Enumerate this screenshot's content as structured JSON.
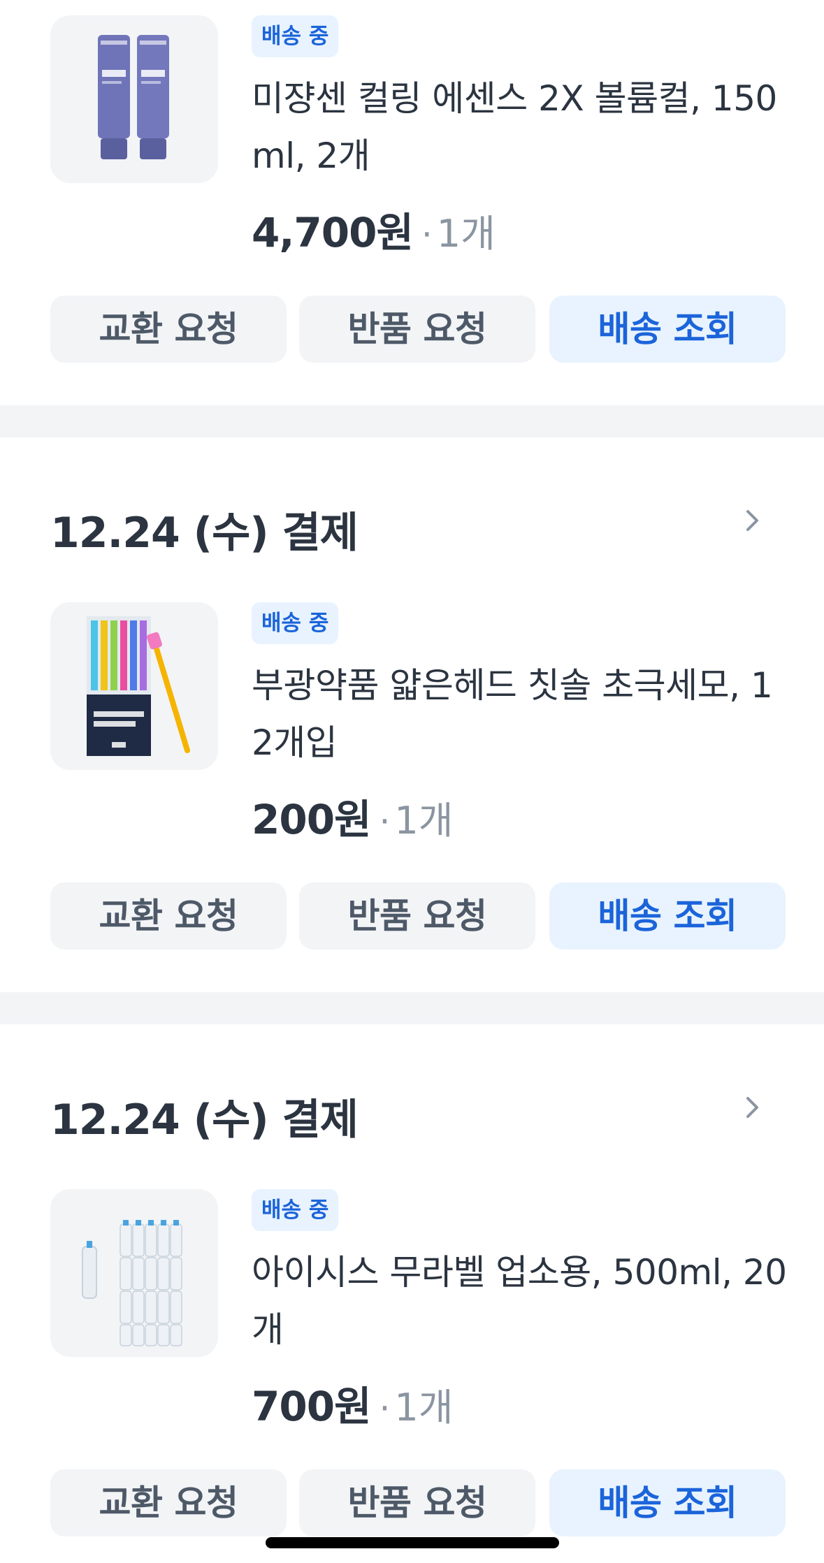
{
  "orders": [
    {
      "date": "",
      "item": {
        "status_badge": "배송 중",
        "name": "미쟝센 컬링 에센스 2X 볼륨컬, 150ml, 2개",
        "price": "4,700원",
        "separator": "·",
        "quantity": "1개",
        "thumbnail_icon": "hair-essence-tubes-image"
      },
      "actions": [
        "교환 요청",
        "반품 요청",
        "배송 조회"
      ]
    },
    {
      "date": "12.24 (수) 결제",
      "item": {
        "status_badge": "배송 중",
        "name": "부광약품 얇은헤드 칫솔 초극세모, 12개입",
        "price": "200원",
        "separator": "·",
        "quantity": "1개",
        "thumbnail_icon": "toothbrush-pack-image"
      },
      "actions": [
        "교환 요청",
        "반품 요청",
        "배송 조회"
      ]
    },
    {
      "date": "12.24 (수) 결제",
      "item": {
        "status_badge": "배송 중",
        "name": "아이시스 무라벨 업소용, 500ml, 20개",
        "price": "700원",
        "separator": "·",
        "quantity": "1개",
        "thumbnail_icon": "water-bottles-image"
      },
      "actions": [
        "교환 요청",
        "반품 요청",
        "배송 조회"
      ]
    }
  ],
  "colors": {
    "badge_bg": "#e8f3ff",
    "badge_text": "#1b64da",
    "button_bg": "#f2f4f6",
    "primary_button_text": "#1b64da",
    "section_gap": "#f2f4f6"
  }
}
